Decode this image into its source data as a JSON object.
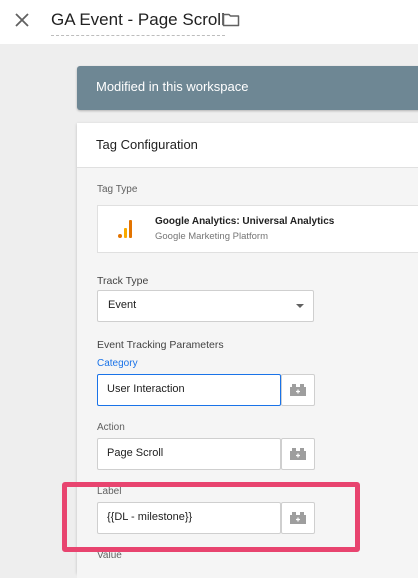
{
  "header": {
    "title": "GA Event - Page Scroll"
  },
  "banner": {
    "text": "Modified in this workspace"
  },
  "card": {
    "title": "Tag Configuration",
    "tag_type": {
      "label": "Tag Type",
      "name": "Google Analytics: Universal Analytics",
      "provider": "Google Marketing Platform"
    },
    "track_type": {
      "label": "Track Type",
      "value": "Event"
    },
    "event_params": {
      "heading": "Event Tracking Parameters",
      "category": {
        "label": "Category",
        "value": "User Interaction"
      },
      "action": {
        "label": "Action",
        "value": "Page Scroll"
      },
      "label": {
        "label": "Label",
        "value": "{{DL - milestone}}"
      },
      "value": {
        "label": "Value"
      }
    }
  },
  "colors": {
    "banner": "#6e8794",
    "highlight": "#e8446f",
    "focus": "#1a73e8",
    "ga_orange": "#f9ab00"
  },
  "icons": [
    "close-icon",
    "folder-icon",
    "google-analytics-icon",
    "dropdown-arrow-icon",
    "variable-picker-icon"
  ]
}
